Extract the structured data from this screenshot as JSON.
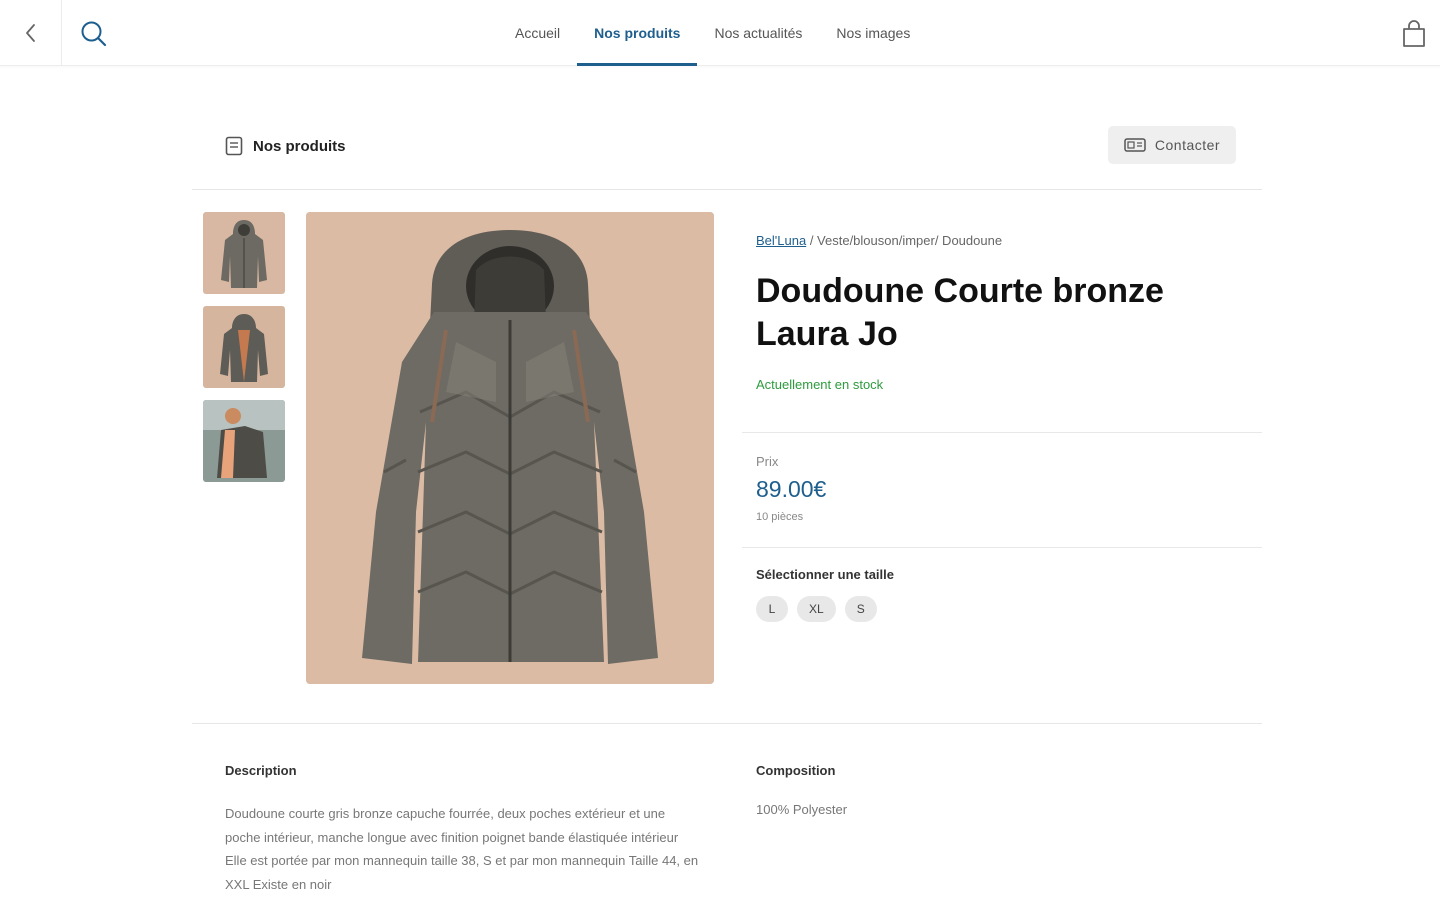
{
  "nav": {
    "tabs": [
      {
        "label": "Accueil"
      },
      {
        "label": "Nos produits"
      },
      {
        "label": "Nos actualités"
      },
      {
        "label": "Nos images"
      }
    ],
    "active_tab": "Nos produits"
  },
  "header": {
    "section_label": "Nos produits",
    "contact_label": "Contacter"
  },
  "product": {
    "brand": "Bel'Luna",
    "category_path": " / Veste/blouson/imper/ Doudoune",
    "title": "Doudoune Courte bronze Laura Jo",
    "stock_status": "Actuellement en stock",
    "price_label": "Prix",
    "price": "89.00€",
    "pieces": "10 pièces",
    "size_label": "Sélectionner une taille",
    "sizes": [
      "L",
      "XL",
      "S"
    ],
    "description_title": "Description",
    "description": "Doudoune courte gris bronze capuche fourrée, deux poches extérieur et une poche intérieur, manche longue avec finition poignet bande élastiquée intérieur Elle est portée par mon mannequin taille 38, S et par mon mannequin Taille 44, en XXL Existe en noir",
    "composition_title": "Composition",
    "composition": "100% Polyester"
  },
  "colors": {
    "accent": "#1e5f8e",
    "stock_green": "#2e9b3e",
    "image_background": "#dcbba5"
  },
  "icons": {
    "back": "chevron-left-icon",
    "search": "search-icon",
    "cart": "shopping-bag-icon",
    "section": "catalog-icon",
    "contact": "card-icon"
  }
}
